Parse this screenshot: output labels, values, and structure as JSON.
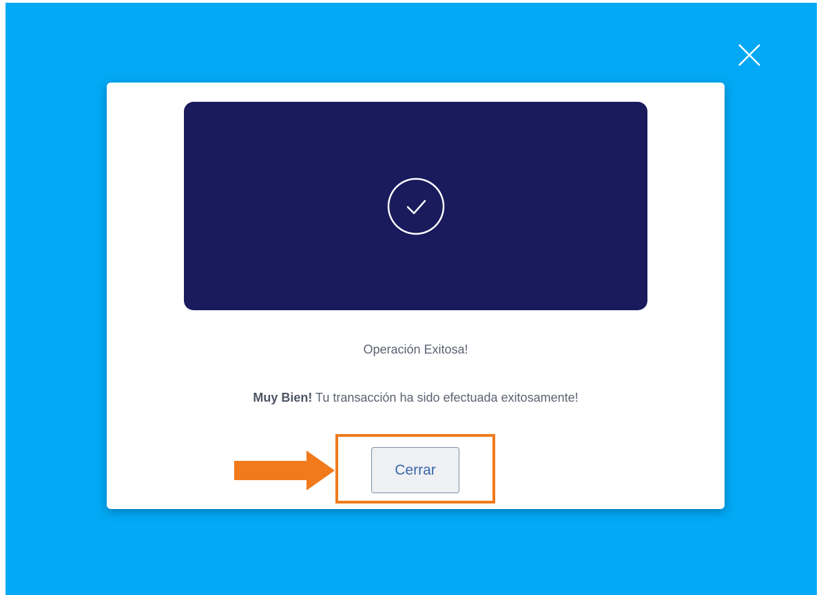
{
  "modal": {
    "title": "Operación Exitosa!",
    "message_bold": "Muy Bien!",
    "message_rest": " Tu transacción ha sido efectuada exitosamente!",
    "close_button_label": "Cerrar"
  },
  "icons": {
    "overlay_close": "close-icon",
    "banner": "check-circle-icon",
    "annotation": "arrow-right-icon"
  },
  "colors": {
    "overlay_background": "#03a9f4",
    "banner_background": "#1a1b5c",
    "annotation": "#f07a1c",
    "button_text": "#3966a8"
  }
}
